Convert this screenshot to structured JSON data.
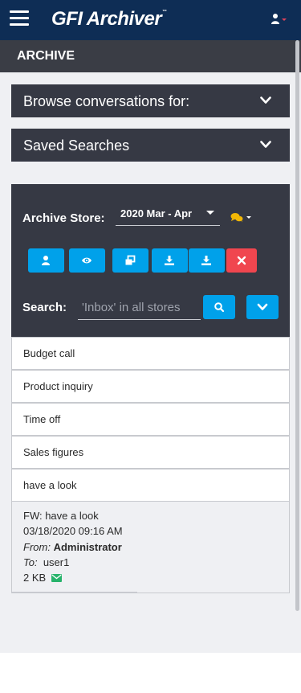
{
  "app": {
    "brand": "GFI Archiver",
    "trademark": "™"
  },
  "header": {
    "section_title": "ARCHIVE"
  },
  "panels": {
    "browse_label": "Browse conversations for:",
    "saved_label": "Saved Searches"
  },
  "archive": {
    "store_label": "Archive Store:",
    "store_value": "2020 Mar - Apr",
    "search_label": "Search:",
    "search_placeholder": "'Inbox' in all stores"
  },
  "actions": [
    {
      "icon": "user-icon",
      "color": "#00a1ea"
    },
    {
      "icon": "eye-icon",
      "color": "#00a1ea"
    },
    {
      "icon": "clone-icon",
      "color": "#00a1ea"
    },
    {
      "icon": "download-icon",
      "color": "#00a1ea"
    },
    {
      "icon": "download-icon",
      "color": "#00a1ea"
    },
    {
      "icon": "close-icon",
      "color": "#f0464f"
    }
  ],
  "messages": [
    {
      "subject": "Budget call"
    },
    {
      "subject": "Product inquiry"
    },
    {
      "subject": "Time off"
    },
    {
      "subject": "Sales figures"
    },
    {
      "subject": "have a look"
    }
  ],
  "selected_message": {
    "subject": "FW: have a look",
    "datetime": "03/18/2020 09:16 AM",
    "from_label": "From:",
    "from": "Administrator",
    "to_label": "To:",
    "to": "user1",
    "size": "2 KB"
  },
  "colors": {
    "topbar": "#0e2d55",
    "panel": "#363944",
    "accent": "#00a1ea",
    "danger": "#f0464f",
    "conversation_icon": "#f2b705",
    "mail_icon": "#27b36b"
  }
}
